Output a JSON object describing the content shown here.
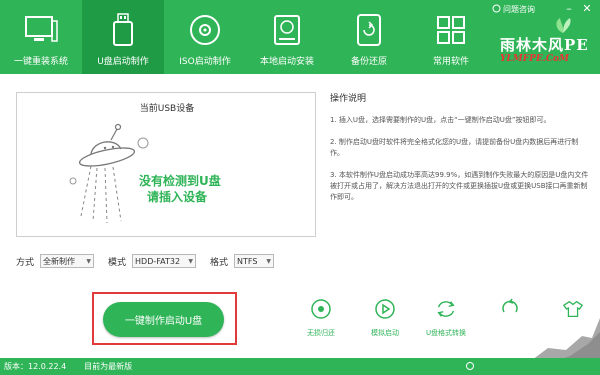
{
  "help_label": "问题咨询",
  "window_controls": {
    "minimize": "–",
    "close": "✕"
  },
  "nav": [
    {
      "label": "一键重装系统",
      "icon": "monitor-icon"
    },
    {
      "label": "U盘启动制作",
      "icon": "usb-drive-icon"
    },
    {
      "label": "ISO启动制作",
      "icon": "disc-icon"
    },
    {
      "label": "本地启动安装",
      "icon": "hard-disk-icon"
    },
    {
      "label": "备份还原",
      "icon": "backup-icon"
    },
    {
      "label": "常用软件",
      "icon": "grid-icon"
    }
  ],
  "logo": {
    "title": "雨林木风PE",
    "subtitle": "YLMFPE.CoM"
  },
  "device_panel": {
    "title": "当前USB设备",
    "message_line1": "没有检测到U盘",
    "message_line2": "请插入设备"
  },
  "instructions": {
    "title": "操作说明",
    "p1": "1. 插入U盘，选择需要制作的U盘，点击“一键制作启动U盘”按钮即可。",
    "p2": "2. 制作启动U盘时软件将完全格式化您的U盘，请提前备份U盘内数据后再进行制作。",
    "p3": "3. 本软件制作U盘启动成功率高达99.9%，如遇到制作失败最大的原因是U盘内文件被打开或占用了，解决方法退出打开的文件或更换插拔U盘或更换USB接口再重新制作即可。"
  },
  "options": {
    "mode_label": "方式",
    "mode_value": "全新制作",
    "partition_label": "模式",
    "partition_value": "HDD-FAT32",
    "format_label": "格式",
    "format_value": "NTFS"
  },
  "main_button_label": "一键制作启动U盘",
  "tools": [
    {
      "label": "无损归还",
      "icon": "restore-icon"
    },
    {
      "label": "模拟启动",
      "icon": "play-icon"
    },
    {
      "label": "U盘格式转换",
      "icon": "convert-icon"
    },
    {
      "label": "",
      "icon": "refresh-icon"
    },
    {
      "label": "",
      "icon": "shirt-icon"
    }
  ],
  "status": {
    "version": "版本：12.0.22.4",
    "update": "目前为最新版"
  },
  "colors": {
    "brand_green": "#2fb457",
    "active_green": "#1f9b45",
    "highlight_red": "#e23a3a"
  }
}
